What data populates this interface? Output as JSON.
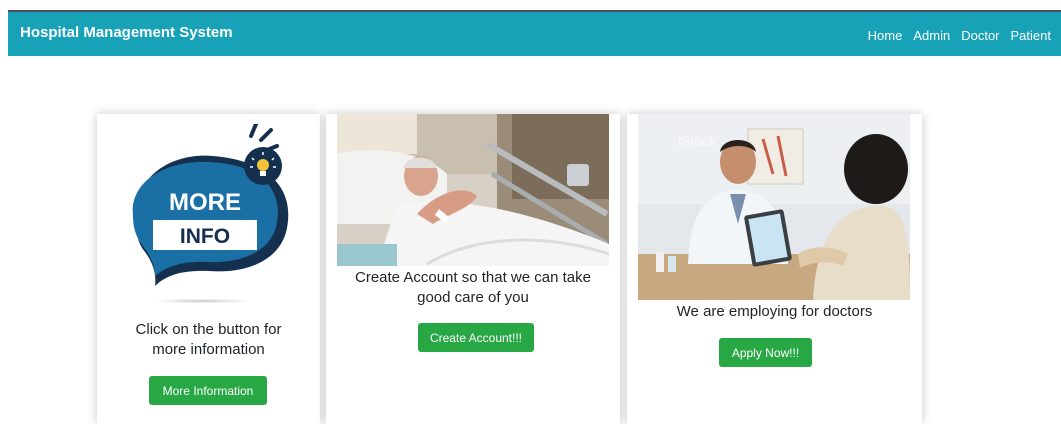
{
  "navbar": {
    "brand": "Hospital Management System",
    "links": [
      "Home",
      "Admin",
      "Doctor",
      "Patient"
    ]
  },
  "cards": [
    {
      "graphic_line1": "MORE",
      "graphic_line2": "INFO",
      "text_line1": "Click on the button for",
      "text_line2": "more information",
      "button": "More Information"
    },
    {
      "text_line1": "Create Account so that we can take",
      "text_line2": "good care of you",
      "button": "Create Account!!!"
    },
    {
      "watermark": "iStock",
      "text_line1": "We are employing for doctors",
      "button": "Apply Now!!!"
    }
  ],
  "colors": {
    "navbar": "#17a2b8",
    "button": "#28a745",
    "graphic_blue": "#1a6fa5"
  }
}
